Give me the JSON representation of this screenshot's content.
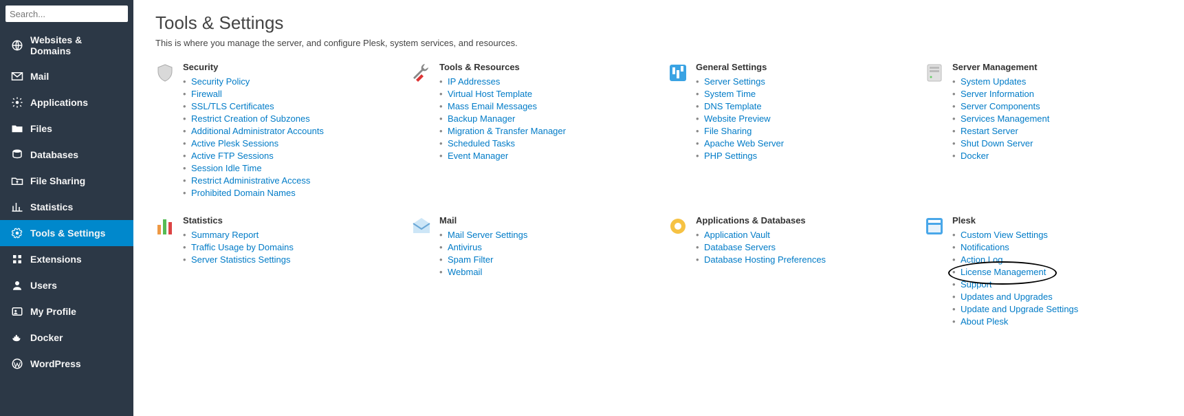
{
  "search": {
    "placeholder": "Search..."
  },
  "sidebar": [
    {
      "id": "websites-domains",
      "label": "Websites & Domains"
    },
    {
      "id": "mail",
      "label": "Mail"
    },
    {
      "id": "applications",
      "label": "Applications"
    },
    {
      "id": "files",
      "label": "Files"
    },
    {
      "id": "databases",
      "label": "Databases"
    },
    {
      "id": "file-sharing",
      "label": "File Sharing"
    },
    {
      "id": "statistics",
      "label": "Statistics"
    },
    {
      "id": "tools-settings",
      "label": "Tools & Settings",
      "active": true
    },
    {
      "id": "extensions",
      "label": "Extensions"
    },
    {
      "id": "users",
      "label": "Users"
    },
    {
      "id": "my-profile",
      "label": "My Profile"
    },
    {
      "id": "docker",
      "label": "Docker"
    },
    {
      "id": "wordpress",
      "label": "WordPress"
    }
  ],
  "page": {
    "title": "Tools & Settings",
    "desc": "This is where you manage the server, and configure Plesk, system services, and resources."
  },
  "rows": [
    [
      {
        "icon": "shield",
        "title": "Security",
        "links": [
          "Security Policy",
          "Firewall",
          "SSL/TLS Certificates",
          "Restrict Creation of Subzones",
          "Additional Administrator Accounts",
          "Active Plesk Sessions",
          "Active FTP Sessions",
          "Session Idle Time",
          "Restrict Administrative Access",
          "Prohibited Domain Names"
        ]
      },
      {
        "icon": "tools",
        "title": "Tools & Resources",
        "links": [
          "IP Addresses",
          "Virtual Host Template",
          "Mass Email Messages",
          "Backup Manager",
          "Migration & Transfer Manager",
          "Scheduled Tasks",
          "Event Manager"
        ]
      },
      {
        "icon": "sliders",
        "title": "General Settings",
        "links": [
          "Server Settings",
          "System Time",
          "DNS Template",
          "Website Preview",
          "File Sharing",
          "Apache Web Server",
          "PHP Settings"
        ]
      },
      {
        "icon": "server",
        "title": "Server Management",
        "links": [
          "System Updates",
          "Server Information",
          "Server Components",
          "Services Management",
          "Restart Server",
          "Shut Down Server",
          "Docker"
        ]
      }
    ],
    [
      {
        "icon": "bars",
        "title": "Statistics",
        "links": [
          "Summary Report",
          "Traffic Usage by Domains",
          "Server Statistics Settings"
        ]
      },
      {
        "icon": "mailopen",
        "title": "Mail",
        "links": [
          "Mail Server Settings",
          "Antivirus",
          "Spam Filter",
          "Webmail"
        ]
      },
      {
        "icon": "apps",
        "title": "Applications & Databases",
        "links": [
          "Application Vault",
          "Database Servers",
          "Database Hosting Preferences"
        ]
      },
      {
        "icon": "plesk",
        "title": "Plesk",
        "links": [
          "Custom View Settings",
          "Notifications",
          "Action Log",
          "License Management",
          "Support",
          "Updates and Upgrades",
          "Update and Upgrade Settings",
          "About Plesk"
        ]
      }
    ]
  ],
  "highlight": {
    "row": 1,
    "col": 3,
    "link": 3
  }
}
